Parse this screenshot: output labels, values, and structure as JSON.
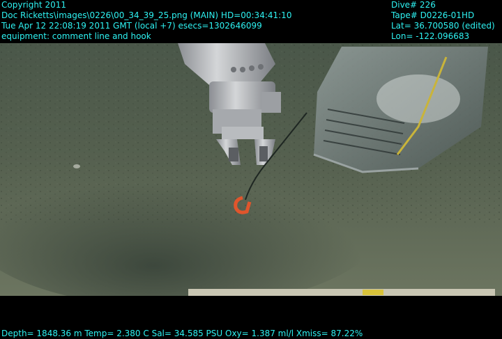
{
  "overlay": {
    "top_left": [
      "Copyright 2011",
      "Doc Ricketts\\images\\0226\\00_34_39_25.png (MAIN)  HD=00:34:41:10",
      "Tue Apr 12 22:08:19 2011 GMT (local +7)  esecs=1302646099",
      "equipment: comment line and hook"
    ],
    "top_right": [
      "Dive# 226",
      "Tape# D0226-01HD",
      "Lat= 36.700580 (edited)",
      "Lon= -122.096683"
    ],
    "bottom": "Depth= 1848.36 m  Temp= 2.380 C  Sal= 34.585 PSU  Oxy= 1.387 ml/l  Xmiss= 87.22%"
  },
  "colors": {
    "overlay_text": "#2ef2f2",
    "seafloor": "#4d5a4b",
    "hook": "#e0552c"
  },
  "scene": {
    "description_elements": [
      "robotic-arm",
      "gripper-claw",
      "hook",
      "line",
      "sampler-basket",
      "seafloor"
    ]
  }
}
